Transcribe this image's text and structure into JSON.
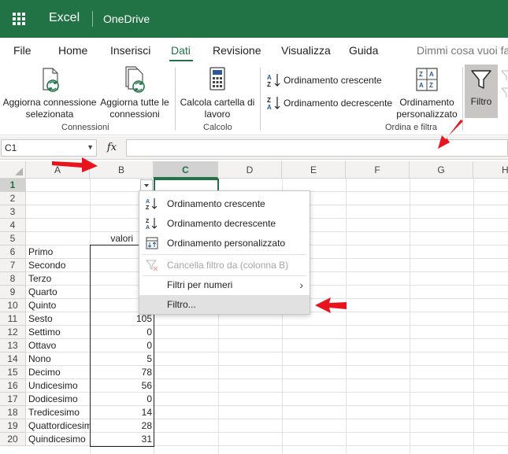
{
  "title_bar": {
    "app_name": "Excel",
    "service": "OneDrive",
    "color": "#217346"
  },
  "ribbon_tabs": [
    {
      "label": "File",
      "active": false
    },
    {
      "label": "Home",
      "active": false
    },
    {
      "label": "Inserisci",
      "active": false
    },
    {
      "label": "Dati",
      "active": true
    },
    {
      "label": "Revisione",
      "active": false
    },
    {
      "label": "Visualizza",
      "active": false
    },
    {
      "label": "Guida",
      "active": false
    }
  ],
  "tell_me": "Dimmi cosa vuoi fa",
  "ribbon": {
    "connessioni": {
      "group_label": "Connessioni",
      "refresh_connection": "Aggiorna connessione selezionata",
      "refresh_all": "Aggiorna tutte le connessioni"
    },
    "calcolo": {
      "group_label": "Calcolo",
      "calculate_workbook": "Calcola cartella di lavoro"
    },
    "ordina_filtra": {
      "group_label": "Ordina e filtra",
      "sort_ascending": "Ordinamento crescente",
      "sort_descending": "Ordinamento decrescente",
      "custom_sort": "Ordinamento personalizzato",
      "filter": "Filtro",
      "filter_pressed": true
    }
  },
  "formula_bar": {
    "name_box": "C1",
    "fx_label": "fx",
    "formula": ""
  },
  "grid": {
    "columns": [
      "A",
      "B",
      "C",
      "D",
      "E",
      "F",
      "G",
      "H"
    ],
    "selected_column": "C",
    "rows": [
      "1",
      "2",
      "3",
      "4",
      "5",
      "6",
      "7",
      "8",
      "9",
      "10",
      "11",
      "12",
      "13",
      "14",
      "15",
      "16",
      "17",
      "18",
      "19",
      "20"
    ],
    "selected_row": "1",
    "header_b5": "valori",
    "column_a": [
      "",
      "",
      "",
      "",
      "",
      "Primo",
      "Secondo",
      "Terzo",
      "Quarto",
      "Quinto",
      "Sesto",
      "Settimo",
      "Ottavo",
      "Nono",
      "Decimo",
      "Undicesimo",
      "Dodicesimo",
      "Tredicesimo",
      "Quattordicesimo",
      "Quindicesimo"
    ],
    "column_b": [
      "",
      "",
      "",
      "",
      "",
      "",
      "",
      "",
      "",
      "",
      "105",
      "0",
      "0",
      "5",
      "78",
      "56",
      "0",
      "14",
      "28",
      "31"
    ]
  },
  "filter_menu": {
    "items": [
      {
        "label": "Ordinamento crescente",
        "icon": "sort-ascending-icon",
        "disabled": false
      },
      {
        "label": "Ordinamento decrescente",
        "icon": "sort-descending-icon",
        "disabled": false
      },
      {
        "label": "Ordinamento personalizzato",
        "icon": "custom-sort-icon",
        "disabled": false
      },
      {
        "label": "Cancella filtro da (colonna B)",
        "icon": "clear-filter-icon",
        "disabled": true
      },
      {
        "label": "Filtri per numeri",
        "icon": "",
        "disabled": false,
        "submenu": true
      },
      {
        "label": "Filtro...",
        "icon": "",
        "disabled": false,
        "highlighted": true
      }
    ]
  },
  "annotations": {
    "arrow_color": "#e8141d"
  }
}
